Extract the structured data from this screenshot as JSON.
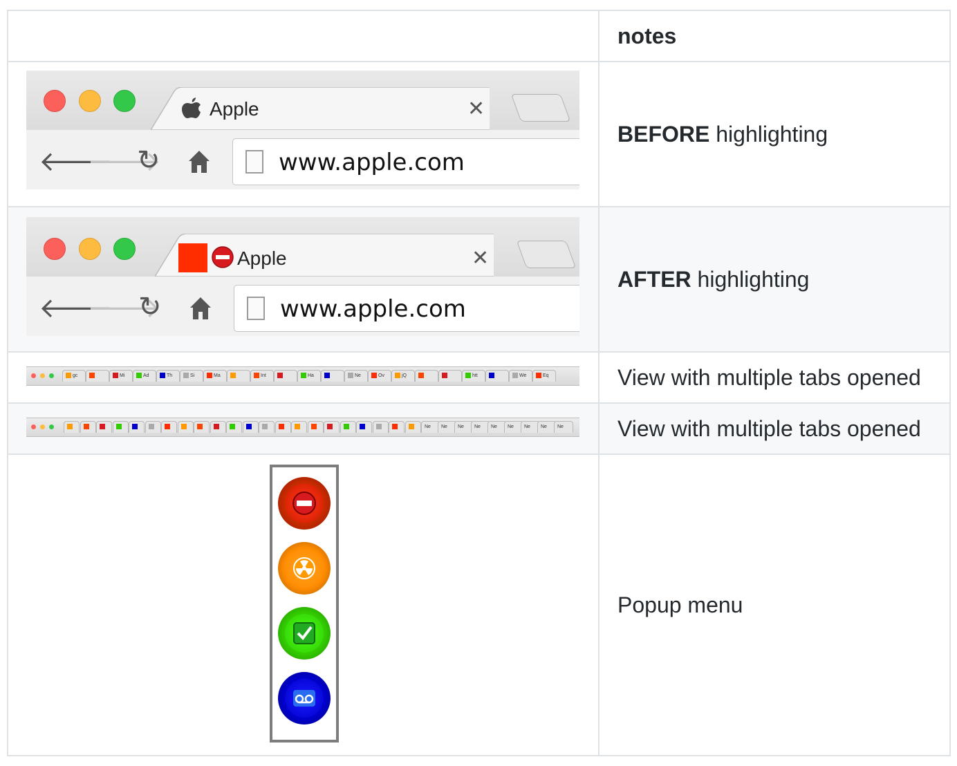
{
  "table": {
    "header_notes": "notes",
    "rows": [
      {
        "bold": "BEFORE",
        "rest": " highlighting"
      },
      {
        "bold": "AFTER",
        "rest": " highlighting"
      },
      {
        "text": "View with multiple tabs opened"
      },
      {
        "text": "View with multiple tabs opened"
      },
      {
        "text": "Popup menu"
      }
    ]
  },
  "before": {
    "tab_title": "Apple",
    "url": "www.apple.com",
    "favicon": "apple-logo-icon"
  },
  "after": {
    "tab_title": "Apple",
    "url": "www.apple.com",
    "favicon": "apple-logo-icon",
    "highlight_marker_color": "#ff2d00",
    "badge": "no-entry-icon"
  },
  "strip1": {
    "tabs": [
      "gc",
      "",
      "Mi",
      "Ad",
      "Th",
      "Si",
      "Ma",
      "",
      "Int",
      "",
      "Ha",
      "",
      "Ne",
      "Ov",
      "jQ",
      "",
      "",
      "htt",
      "",
      "We",
      "Eq"
    ]
  },
  "strip2": {
    "tabs": [
      "Ne",
      "Ne",
      "Ne",
      "Ne",
      "Ne",
      "Ne",
      "Ne",
      "Ne",
      "Ne"
    ]
  },
  "popup": {
    "buttons": [
      {
        "name": "red-stop-button",
        "icon": "no-entry-icon",
        "color": "#e62e00"
      },
      {
        "name": "orange-radiation-button",
        "icon": "radiation-icon",
        "color": "#ff8c00"
      },
      {
        "name": "green-check-button",
        "icon": "check-icon",
        "color": "#33cc00"
      },
      {
        "name": "blue-voicemail-button",
        "icon": "voicemail-icon",
        "color": "#0000cc"
      }
    ]
  }
}
